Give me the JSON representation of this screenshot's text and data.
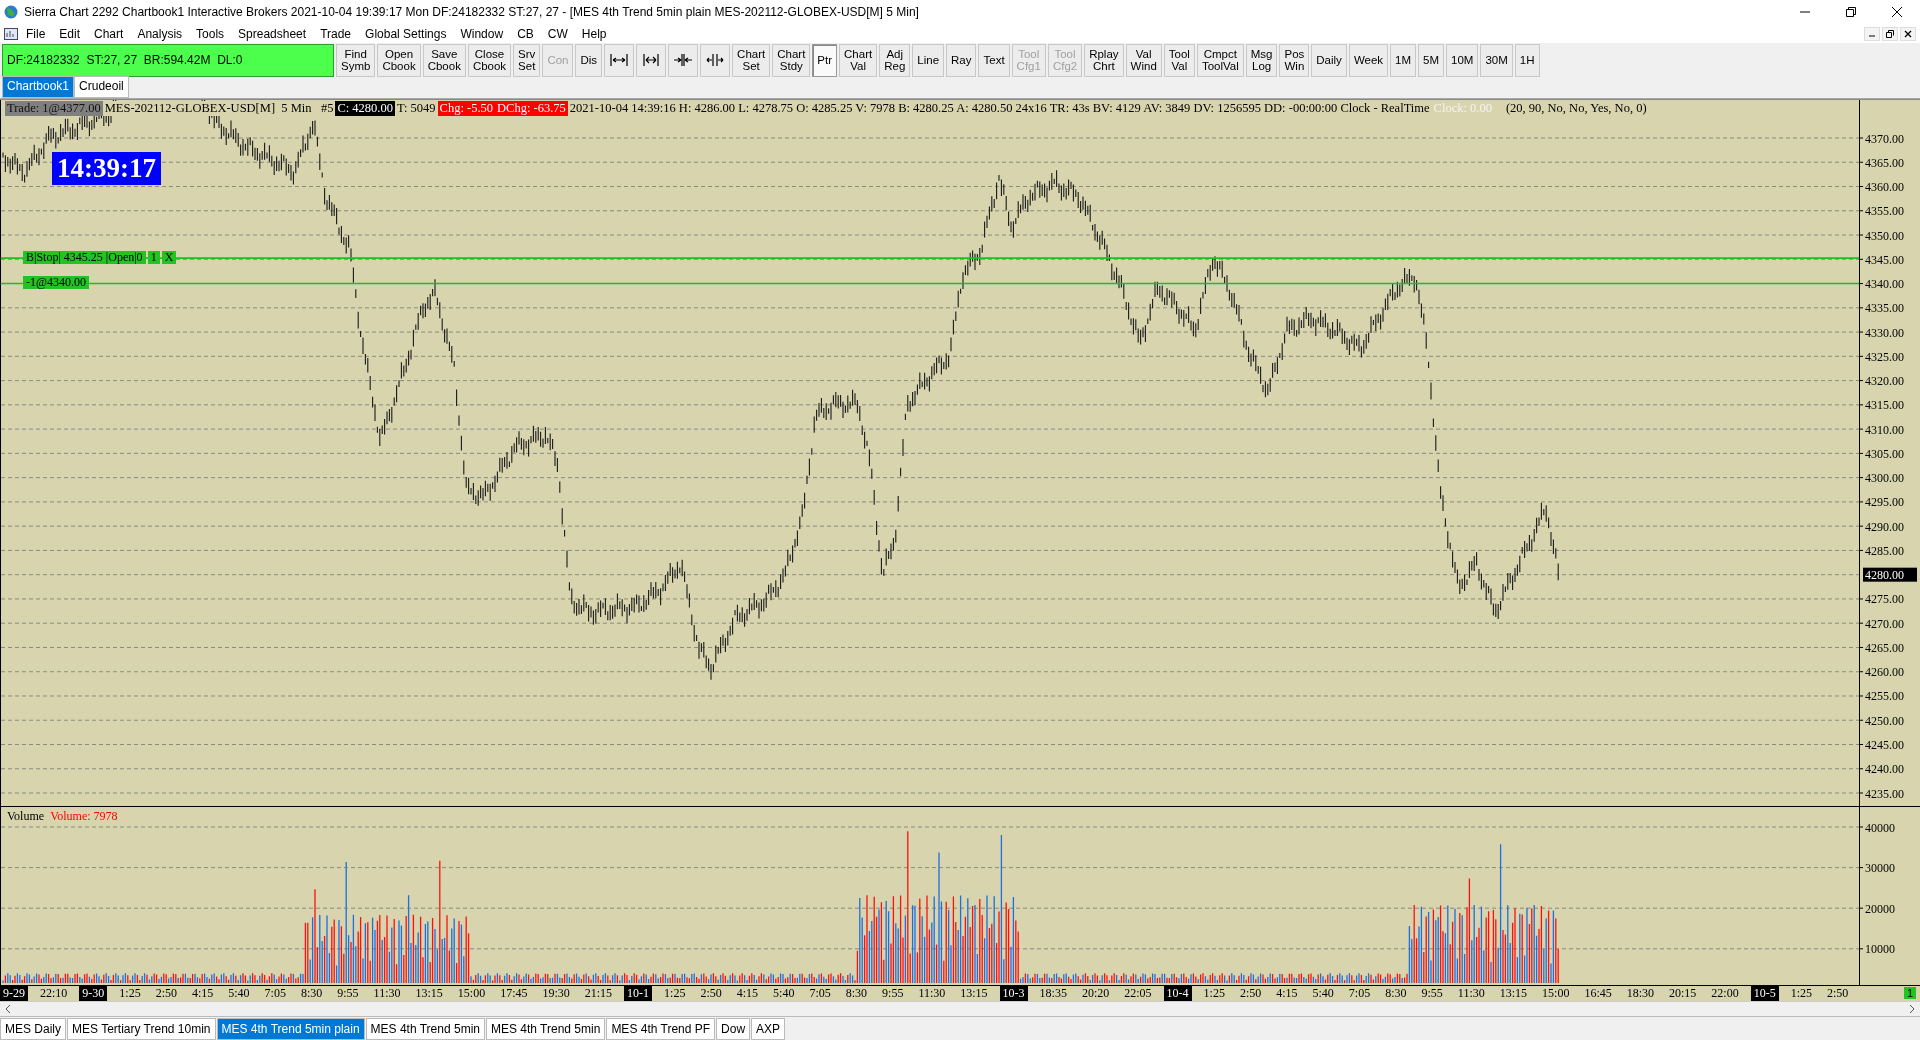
{
  "window": {
    "title": "Sierra Chart 2292 Chartbook1  Interactive Brokers 2021-10-04  19:39:17 Mon  DF:24182332  ST:27, 27 - [MES 4th Trend 5min plain MES-202112-GLOBEX-USD[M]  5 Min]"
  },
  "menu": [
    "File",
    "Edit",
    "Chart",
    "Analysis",
    "Tools",
    "Spreadsheet",
    "Trade",
    "Global Settings",
    "Window",
    "CB",
    "CW",
    "Help"
  ],
  "status_box": "DF:24182332  ST:27, 27  BR:594.42M  DL:0",
  "toolbar": [
    {
      "kind": "text",
      "label": "Find Symb",
      "disabled": false,
      "selected": false
    },
    {
      "kind": "text",
      "label": "Open Cbook",
      "disabled": false,
      "selected": false
    },
    {
      "kind": "text",
      "label": "Save Cbook",
      "disabled": false,
      "selected": false
    },
    {
      "kind": "text",
      "label": "Close Cbook",
      "disabled": false,
      "selected": false
    },
    {
      "kind": "text",
      "label": "Srv Set",
      "disabled": false,
      "selected": false
    },
    {
      "kind": "text",
      "label": "Con",
      "disabled": true,
      "selected": false
    },
    {
      "kind": "text",
      "label": "Dis",
      "disabled": false,
      "selected": false
    },
    {
      "kind": "icon"
    },
    {
      "kind": "icon"
    },
    {
      "kind": "icon"
    },
    {
      "kind": "icon"
    },
    {
      "kind": "text",
      "label": "Chart Set",
      "disabled": false,
      "selected": false
    },
    {
      "kind": "text",
      "label": "Chart Stdy",
      "disabled": false,
      "selected": false
    },
    {
      "kind": "text",
      "label": "Ptr",
      "disabled": false,
      "selected": true
    },
    {
      "kind": "text",
      "label": "Chart Val",
      "disabled": false,
      "selected": false
    },
    {
      "kind": "text",
      "label": "Adj Reg",
      "disabled": false,
      "selected": false
    },
    {
      "kind": "text",
      "label": "Line",
      "disabled": false,
      "selected": false
    },
    {
      "kind": "text",
      "label": "Ray",
      "disabled": false,
      "selected": false
    },
    {
      "kind": "text",
      "label": "Text",
      "disabled": false,
      "selected": false
    },
    {
      "kind": "text",
      "label": "Tool Cfg1",
      "disabled": true,
      "selected": false
    },
    {
      "kind": "text",
      "label": "Tool Cfg2",
      "disabled": true,
      "selected": false
    },
    {
      "kind": "text",
      "label": "Rplay Chrt",
      "disabled": false,
      "selected": false
    },
    {
      "kind": "text",
      "label": "Val Wind",
      "disabled": false,
      "selected": false
    },
    {
      "kind": "text",
      "label": "Tool Val",
      "disabled": false,
      "selected": false
    },
    {
      "kind": "text",
      "label": "Cmpct ToolVal",
      "disabled": false,
      "selected": false
    },
    {
      "kind": "text",
      "label": "Msg Log",
      "disabled": false,
      "selected": false
    },
    {
      "kind": "text",
      "label": "Pos Win",
      "disabled": false,
      "selected": false
    },
    {
      "kind": "text",
      "label": "Daily",
      "disabled": false,
      "selected": false
    },
    {
      "kind": "text",
      "label": "Week",
      "disabled": false,
      "selected": false
    },
    {
      "kind": "text",
      "label": "1M",
      "disabled": false,
      "selected": false
    },
    {
      "kind": "text",
      "label": "5M",
      "disabled": false,
      "selected": false
    },
    {
      "kind": "text",
      "label": "10M",
      "disabled": false,
      "selected": false
    },
    {
      "kind": "text",
      "label": "30M",
      "disabled": false,
      "selected": false
    },
    {
      "kind": "text",
      "label": "1H",
      "disabled": false,
      "selected": false
    }
  ],
  "chartbook_tabs": [
    {
      "label": "Chartbook1",
      "selected": true
    },
    {
      "label": "Crudeoil",
      "selected": false
    }
  ],
  "chart": {
    "info_line": [
      {
        "kind": "grey",
        "text": "Trade: 1@4377.00"
      },
      {
        "kind": "plain",
        "text": "MES-202112-GLOBEX-USD[M]  5 Min   #5"
      },
      {
        "kind": "black",
        "text": "C: 4280.00"
      },
      {
        "kind": "plain",
        "text": "T: 5049"
      },
      {
        "kind": "red",
        "text": "Chg: -5.50"
      },
      {
        "kind": "red",
        "text": "DChg: -63.75"
      },
      {
        "kind": "plain",
        "text": "2021-10-04 14:39:16 H: 4286.00 L: 4278.75 O: 4285.25 V: 7978 B: 4280.25 A: 4280.50 24x16 TR: 43s BV: 4129 AV: 3849 DV: 1256595 DD: -00:00:00 Clock - RealTime"
      },
      {
        "kind": "faint",
        "text": "Clock: 0.00"
      },
      {
        "kind": "plain",
        "text": "(20, 90, No, No, Yes, No, 0)"
      }
    ],
    "clock": "14:39:17",
    "orders": [
      {
        "parts": [
          "B|Stop| 4345.25 |Open|0",
          "1",
          "X"
        ]
      },
      {
        "parts": [
          "-1@4340.00"
        ]
      }
    ],
    "price_axis": [
      {
        "kind": "tick",
        "text": "4370.00"
      },
      {
        "kind": "tick",
        "text": "4365.00"
      },
      {
        "kind": "tick",
        "text": "4360.00"
      },
      {
        "kind": "tick",
        "text": "4355.00"
      },
      {
        "kind": "tick",
        "text": "4350.00"
      },
      {
        "kind": "tick",
        "text": "4345.00"
      },
      {
        "kind": "tick",
        "text": "4340.00"
      },
      {
        "kind": "tick",
        "text": "4335.00"
      },
      {
        "kind": "tick",
        "text": "4330.00"
      },
      {
        "kind": "tick",
        "text": "4325.00"
      },
      {
        "kind": "tick",
        "text": "4320.00"
      },
      {
        "kind": "tick",
        "text": "4315.00"
      },
      {
        "kind": "tick",
        "text": "4310.00"
      },
      {
        "kind": "tick",
        "text": "4305.00"
      },
      {
        "kind": "tick",
        "text": "4300.00"
      },
      {
        "kind": "tick",
        "text": "4295.00"
      },
      {
        "kind": "tick",
        "text": "4290.00"
      },
      {
        "kind": "tick",
        "text": "4285.00"
      },
      {
        "kind": "current",
        "text": "4280.00"
      },
      {
        "kind": "tick",
        "text": "4275.00"
      },
      {
        "kind": "tick",
        "text": "4270.00"
      },
      {
        "kind": "tick",
        "text": "4265.00"
      },
      {
        "kind": "tick",
        "text": "4260.00"
      },
      {
        "kind": "tick",
        "text": "4255.00"
      },
      {
        "kind": "tick",
        "text": "4250.00"
      },
      {
        "kind": "tick",
        "text": "4245.00"
      },
      {
        "kind": "tick",
        "text": "4240.00"
      },
      {
        "kind": "tick",
        "text": "4235.00"
      }
    ],
    "volume": {
      "label": "Volume",
      "reading": "Volume: 7978",
      "axis": [
        "40000",
        "30000",
        "20000",
        "10000"
      ]
    },
    "time_axis": [
      {
        "kind": "date",
        "text": "9-29"
      },
      {
        "kind": "time",
        "text": "22:10"
      },
      {
        "kind": "date",
        "text": "9-30"
      },
      {
        "kind": "time",
        "text": "1:25"
      },
      {
        "kind": "time",
        "text": "2:50"
      },
      {
        "kind": "time",
        "text": "4:15"
      },
      {
        "kind": "time",
        "text": "5:40"
      },
      {
        "kind": "time",
        "text": "7:05"
      },
      {
        "kind": "time",
        "text": "8:30"
      },
      {
        "kind": "time",
        "text": "9:55"
      },
      {
        "kind": "time",
        "text": "11:30"
      },
      {
        "kind": "time",
        "text": "13:15"
      },
      {
        "kind": "time",
        "text": "15:00"
      },
      {
        "kind": "time",
        "text": "17:45"
      },
      {
        "kind": "time",
        "text": "19:30"
      },
      {
        "kind": "time",
        "text": "21:15"
      },
      {
        "kind": "date",
        "text": "10-1"
      },
      {
        "kind": "time",
        "text": "1:25"
      },
      {
        "kind": "time",
        "text": "2:50"
      },
      {
        "kind": "time",
        "text": "4:15"
      },
      {
        "kind": "time",
        "text": "5:40"
      },
      {
        "kind": "time",
        "text": "7:05"
      },
      {
        "kind": "time",
        "text": "8:30"
      },
      {
        "kind": "time",
        "text": "9:55"
      },
      {
        "kind": "time",
        "text": "11:30"
      },
      {
        "kind": "time",
        "text": "13:15"
      },
      {
        "kind": "date",
        "text": "10-3"
      },
      {
        "kind": "time",
        "text": "18:35"
      },
      {
        "kind": "time",
        "text": "20:20"
      },
      {
        "kind": "time",
        "text": "22:05"
      },
      {
        "kind": "date",
        "text": "10-4"
      },
      {
        "kind": "time",
        "text": "1:25"
      },
      {
        "kind": "time",
        "text": "2:50"
      },
      {
        "kind": "time",
        "text": "4:15"
      },
      {
        "kind": "time",
        "text": "5:40"
      },
      {
        "kind": "time",
        "text": "7:05"
      },
      {
        "kind": "time",
        "text": "8:30"
      },
      {
        "kind": "time",
        "text": "9:55"
      },
      {
        "kind": "time",
        "text": "11:30"
      },
      {
        "kind": "time",
        "text": "13:15"
      },
      {
        "kind": "time",
        "text": "15:00"
      },
      {
        "kind": "time",
        "text": "16:45"
      },
      {
        "kind": "time",
        "text": "18:30"
      },
      {
        "kind": "time",
        "text": "20:15"
      },
      {
        "kind": "time",
        "text": "22:00"
      },
      {
        "kind": "date",
        "text": "10-5"
      },
      {
        "kind": "time",
        "text": "1:25"
      },
      {
        "kind": "time",
        "text": "2:50"
      }
    ],
    "corner_badge": "1"
  },
  "bottom_tabs": [
    {
      "label": "MES Daily",
      "selected": false
    },
    {
      "label": "MES Tertiary Trend 10min",
      "selected": false
    },
    {
      "label": "MES 4th Trend 5min plain",
      "selected": true
    },
    {
      "label": "MES 4th Trend 5min",
      "selected": false
    },
    {
      "label": "MES 4th Trend 5min",
      "selected": false
    },
    {
      "label": "MES 4th Trend PF",
      "selected": false
    },
    {
      "label": "Dow",
      "selected": false
    },
    {
      "label": "AXP",
      "selected": false
    }
  ]
}
